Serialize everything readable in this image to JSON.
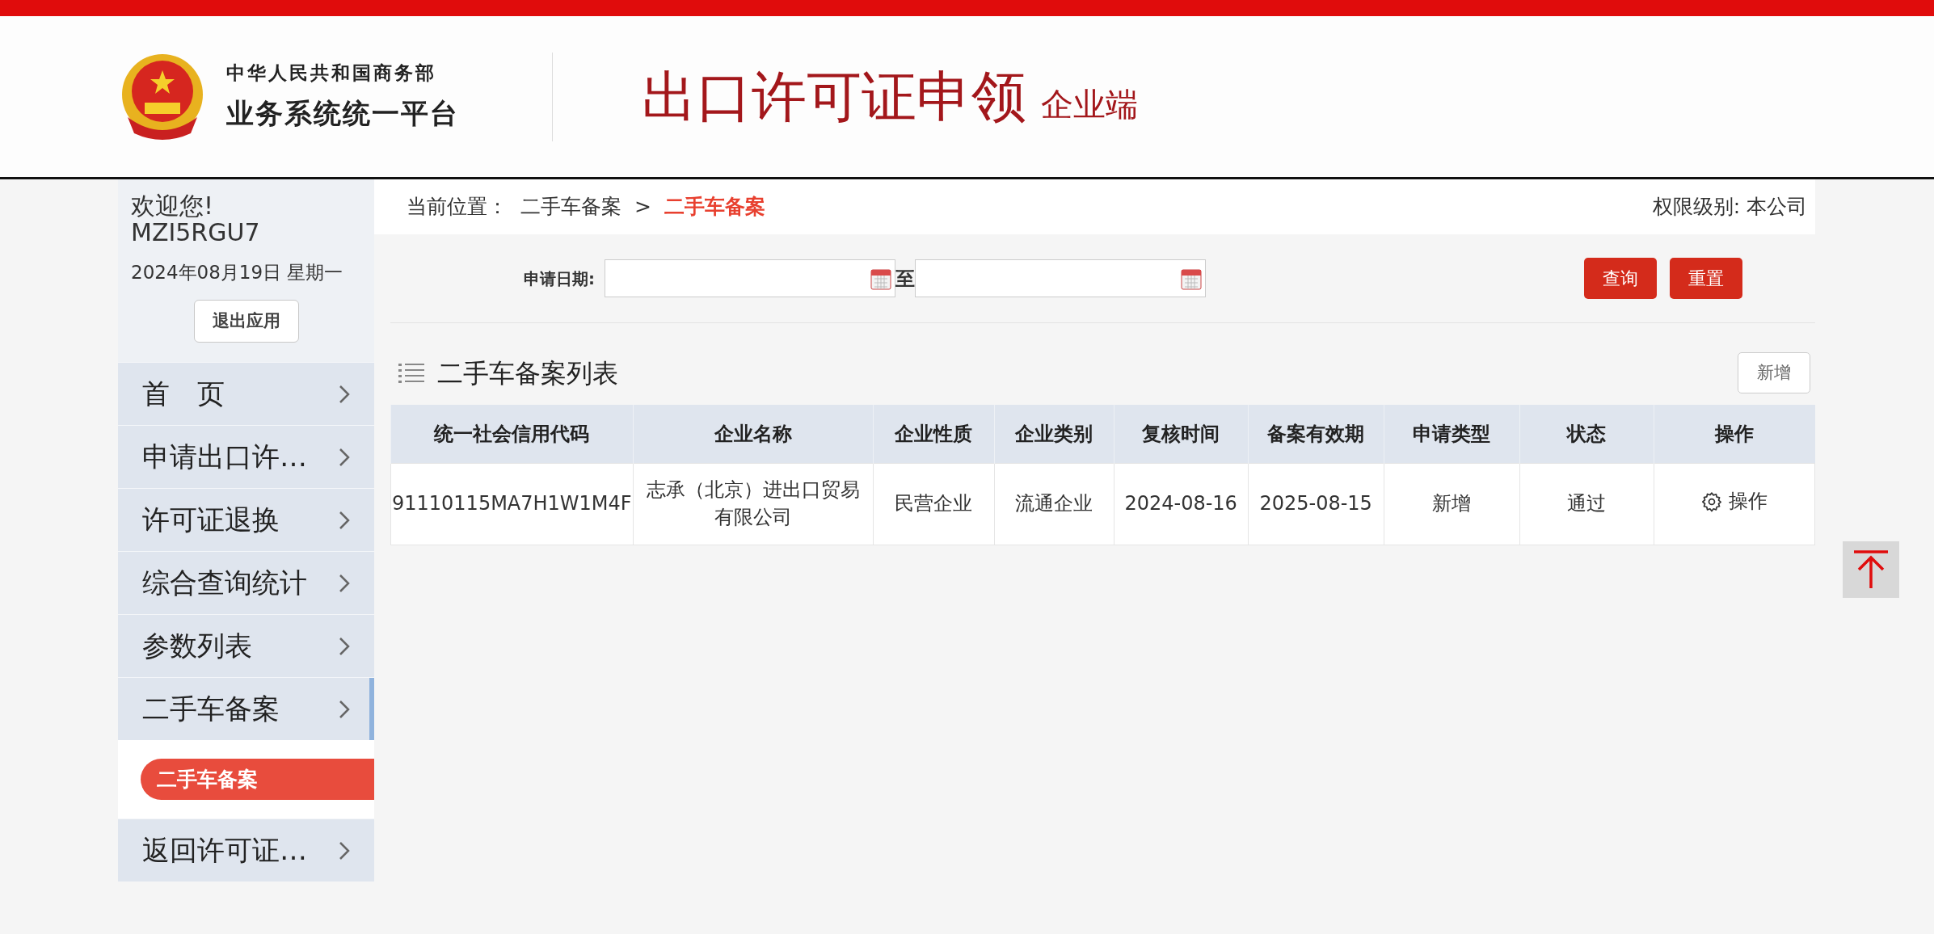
{
  "header": {
    "org_line": "中华人民共和国商务部",
    "platform": "业务系统统一平台",
    "title": "出口许可证申领",
    "subtitle": "企业端"
  },
  "sidebar": {
    "welcome": "欢迎您!",
    "user": "MZI5RGU7",
    "date": "2024年08月19日 星期一",
    "logout": "退出应用",
    "menu": [
      {
        "label": "首　页",
        "expanded": false
      },
      {
        "label": "申请出口许…",
        "expanded": false
      },
      {
        "label": "许可证退换",
        "expanded": false
      },
      {
        "label": "综合查询统计",
        "expanded": false
      },
      {
        "label": "参数列表",
        "expanded": false
      },
      {
        "label": "二手车备案",
        "expanded": true,
        "children": [
          {
            "label": "二手车备案",
            "selected": true
          }
        ]
      },
      {
        "label": "返回许可证…",
        "expanded": false
      }
    ]
  },
  "breadcrumb": {
    "prefix": "当前位置：",
    "parent": "二手车备案",
    "separator": ">",
    "current": "二手车备案",
    "permission": "权限级别: 本公司"
  },
  "filter": {
    "label": "申请日期:",
    "to": "至",
    "buttons": [
      "查询",
      "重置"
    ]
  },
  "list": {
    "title": "二手车备案列表",
    "add_button": "新增",
    "table": {
      "columns": [
        "统一社会信用代码",
        "企业名称",
        "企业性质",
        "企业类别",
        "复核时间",
        "备案有效期",
        "申请类型",
        "状态",
        "操作"
      ],
      "rows": [
        {
          "cells": [
            "91110115MA7H1W1M4F",
            "志承（北京）进出口贸易有限公司",
            "民营企业",
            "流通企业",
            "2024-08-16",
            "2025-08-15",
            "新增",
            "通过"
          ],
          "action": "操作"
        }
      ]
    }
  }
}
